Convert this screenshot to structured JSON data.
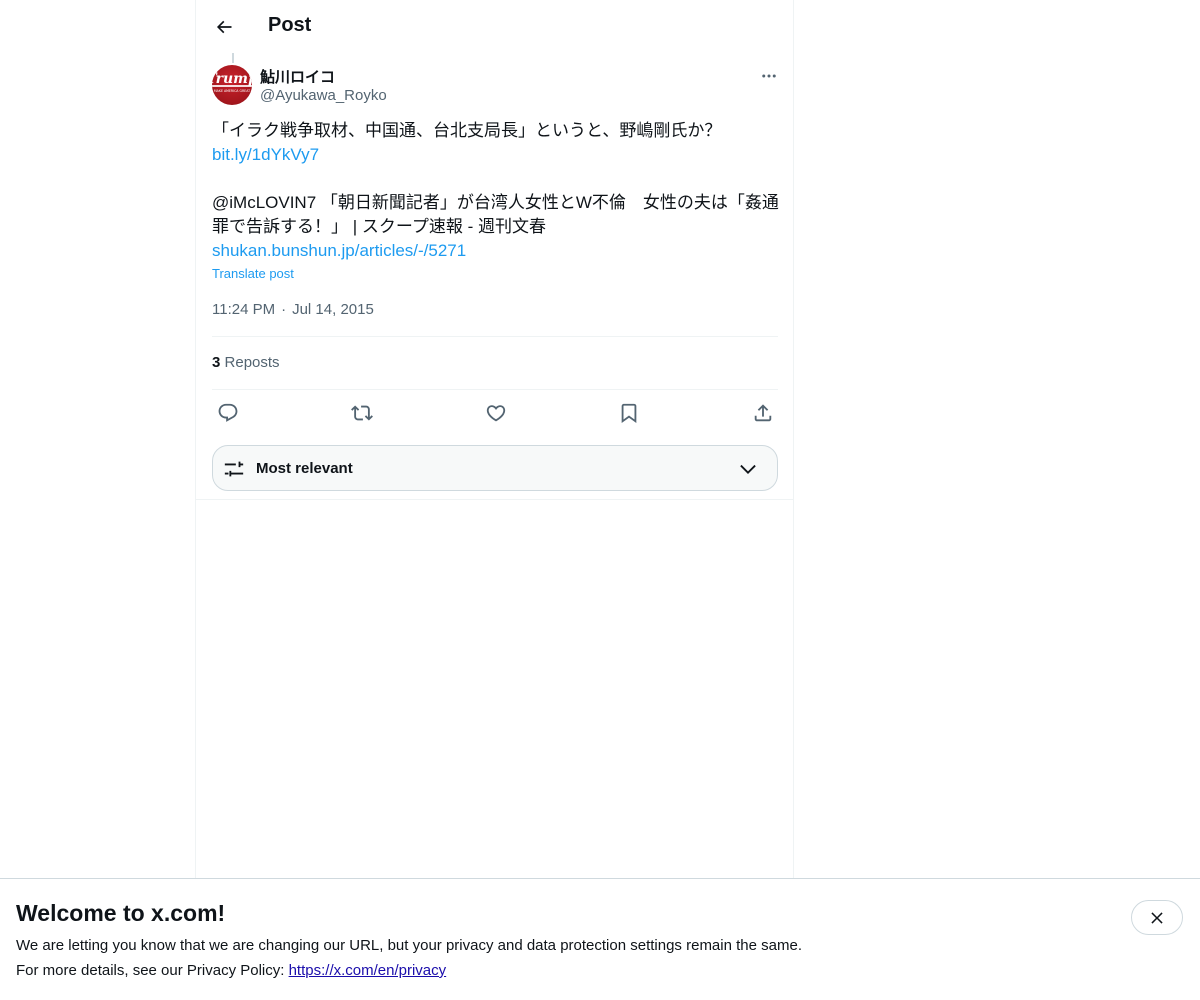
{
  "header": {
    "title": "Post"
  },
  "post": {
    "author_name": "鮎川ロイコ",
    "author_handle": "@Ayukawa_Royko",
    "avatar_text": "Trump",
    "avatar_subtext": "MAKE AMERICA GREAT",
    "text_line1": "「イラク戦争取材、中国通、台北支局長」というと、野嶋剛氏か？",
    "link1": "bit.ly/1dYkVy7",
    "text_line2": "@iMcLOVIN7 「朝日新聞記者」が台湾人女性とW不倫　女性の夫は「姦通",
    "text_line3": "罪で告訴する！」 | スクープ速報 - 週刊文春",
    "link2": "shukan.bunshun.jp/articles/-/5271",
    "translate_label": "Translate post",
    "time": "11:24 PM",
    "separator": "·",
    "date": "Jul 14, 2015",
    "repost_count": "3",
    "repost_label": "Reposts"
  },
  "actions": {
    "reply_icon": "reply-icon",
    "repost_icon": "repost-icon",
    "like_icon": "heart-icon",
    "bookmark_icon": "bookmark-icon",
    "share_icon": "share-icon"
  },
  "sort": {
    "label": "Most relevant"
  },
  "banner": {
    "title": "Welcome to x.com!",
    "line1": "We are letting you know that we are changing our URL, but your privacy and data protection settings remain the same.",
    "line2_prefix": "For more details, see our Privacy Policy: ",
    "line2_link": "https://x.com/en/privacy"
  },
  "colors": {
    "accent": "#1d9bf0",
    "text_primary": "#0f1419",
    "text_secondary": "#536471",
    "border": "#eff3f4",
    "avatar_red": "#b51c24"
  }
}
